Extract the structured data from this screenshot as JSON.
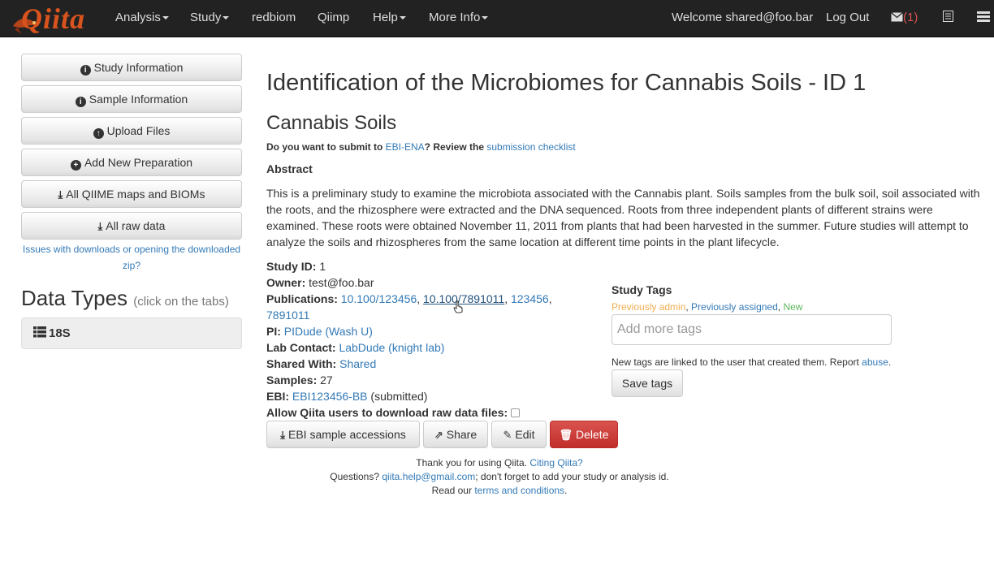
{
  "nav": {
    "brand": "Qiita",
    "analysis": "Analysis",
    "study": "Study",
    "redbiom": "redbiom",
    "qiimp": "Qiimp",
    "help": "Help",
    "more_info": "More Info",
    "welcome": "Welcome shared@foo.bar",
    "logout": "Log Out",
    "msg_count": "(1)"
  },
  "sidebar": {
    "study_information": "Study Information",
    "sample_information": "Sample Information",
    "upload_files": "Upload Files",
    "add_new_preparation": "Add New Preparation",
    "all_qiime_maps": "All QIIME maps and BIOMs",
    "all_raw_data": "All raw data",
    "issues_link": "Issues with downloads or opening the downloaded zip?",
    "data_types_title": "Data Types",
    "data_types_hint": "(click on the tabs)",
    "tab_18s": "18S"
  },
  "main": {
    "title": "Identification of the Microbiomes for Cannabis Soils - ID 1",
    "subtitle": "Cannabis Soils",
    "ebi_prefix": "Do you want to submit to ",
    "ebi_link": "EBI-ENA",
    "ebi_middle": "? Review the ",
    "checklist_link": "submission checklist",
    "abstract_label": "Abstract",
    "abstract": "This is a preliminary study to examine the microbiota associated with the Cannabis plant. Soils samples from the bulk soil, soil associated with the roots, and the rhizosphere were extracted and the DNA sequenced. Roots from three independent plants of different strains were examined. These roots were obtained November 11, 2011 from plants that had been harvested in the summer. Future studies will attempt to analyze the soils and rhizospheres from the same location at different time points in the plant lifecycle.",
    "study_id_label": "Study ID:",
    "study_id": "1",
    "owner_label": "Owner:",
    "owner": "test@foo.bar",
    "publications_label": "Publications:",
    "pub1": "10.100/123456",
    "pub2": "10.100/7891011",
    "pub3": "123456",
    "pub4": "7891011",
    "pi_label": "PI:",
    "pi": "PIDude (Wash U)",
    "lab_contact_label": "Lab Contact:",
    "lab_contact": "LabDude (knight lab)",
    "shared_with_label": "Shared With:",
    "shared_with": "Shared",
    "samples_label": "Samples:",
    "samples": "27",
    "ebi_label": "EBI:",
    "ebi_accession": "EBI123456-BB",
    "ebi_status": "(submitted)",
    "allow_download_label": "Allow Qiita users to download raw data files:",
    "btn_ebi_accessions": "EBI sample accessions",
    "btn_share": "Share",
    "btn_edit": "Edit",
    "btn_delete": "Delete"
  },
  "tags": {
    "title": "Study Tags",
    "prev_admin": "Previously admin",
    "prev_assigned": "Previously assigned",
    "new": "New",
    "input_placeholder": "Add more tags",
    "note_prefix": "New tags are linked to the user that created them. Report ",
    "abuse_link": "abuse",
    "note_suffix": ".",
    "save_button": "Save tags"
  },
  "footer": {
    "thanks": "Thank you for using Qiita. ",
    "citing_link": "Citing Qiita?",
    "questions": "Questions? ",
    "email_link": "qiita.help@gmail.com",
    "questions_suffix": "; don't forget to add your study or analysis id.",
    "read_our": "Read our ",
    "terms_link": "terms and conditions",
    "period": "."
  },
  "colors": {
    "navbar": "#222222",
    "link": "#337ab7",
    "danger": "#d9534f",
    "brand": "#d9531e"
  }
}
